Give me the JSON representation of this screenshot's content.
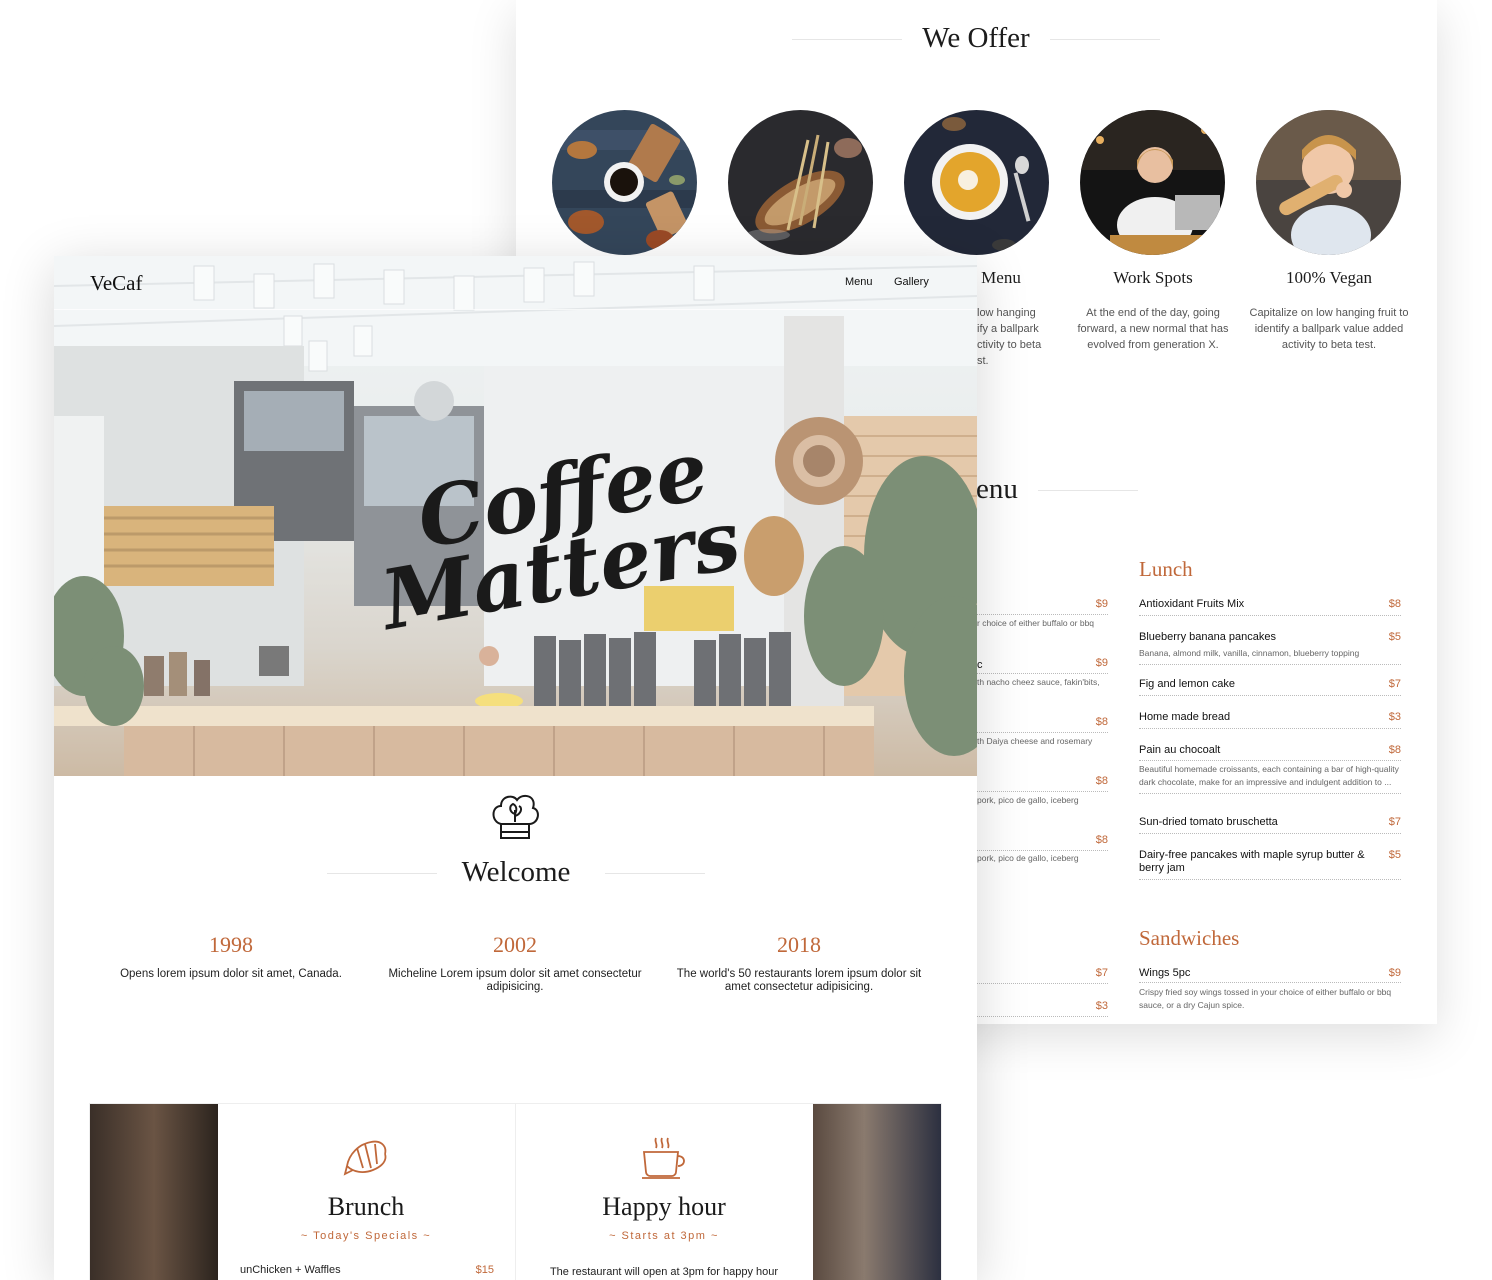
{
  "back": {
    "offer": {
      "title": "We Offer",
      "items": [
        {
          "name": "",
          "desc": ""
        },
        {
          "name": "",
          "desc": ""
        },
        {
          "name": "Menu",
          "desc": "low hanging\nify a ballpark\nctivity to beta\nst."
        },
        {
          "name": "Work Spots",
          "desc": "At the end of the day, going forward, a new normal that has evolved from generation X."
        },
        {
          "name": "100% Vegan",
          "desc": "Capitalize on low hanging fruit to identify a ballpark value added activity to beta test."
        }
      ]
    },
    "menu": {
      "title_partial": "enu",
      "left_cut": {
        "prices": [
          "$9",
          "$9",
          "$8",
          "$8",
          "$8",
          "$7",
          "$3"
        ],
        "descs": [
          "r choice of either buffalo or bbq",
          "c",
          "th nacho cheez sauce, fakin'bits,",
          "th Daiya cheese and rosemary",
          "pork, pico de gallo, iceberg",
          "pork, pico de gallo, iceberg"
        ]
      },
      "lunch": {
        "title": "Lunch",
        "items": [
          {
            "name": "Antioxidant Fruits Mix",
            "price": "$8",
            "desc": ""
          },
          {
            "name": "Blueberry banana pancakes",
            "price": "$5",
            "desc": "Banana, almond milk, vanilla, cinnamon, blueberry topping"
          },
          {
            "name": "Fig and lemon cake",
            "price": "$7",
            "desc": ""
          },
          {
            "name": "Home made bread",
            "price": "$3",
            "desc": ""
          },
          {
            "name": "Pain au chocoalt",
            "price": "$8",
            "desc": "Beautiful homemade croissants, each containing a bar of high-quality dark chocolate, make for an impressive and indulgent addition to ..."
          },
          {
            "name": "Sun-dried tomato bruschetta",
            "price": "$7",
            "desc": ""
          },
          {
            "name": "Dairy-free pancakes with maple syrup butter & berry jam",
            "price": "$5",
            "desc": ""
          }
        ]
      },
      "sandwiches": {
        "title": "Sandwiches",
        "items": [
          {
            "name": "Wings 5pc",
            "price": "$9",
            "desc": "Crispy fried soy wings tossed in your choice of either buffalo or bbq sauce, or a dry Cajun spice."
          }
        ]
      }
    }
  },
  "front": {
    "logo": "VeCaf",
    "nav": [
      "Menu",
      "Gallery"
    ],
    "hero": {
      "line1": "Coffee",
      "line2": "Matters"
    },
    "welcome": "Welcome",
    "timeline": [
      {
        "year": "1998",
        "text": "Opens lorem ipsum dolor sit amet, Canada."
      },
      {
        "year": "2002",
        "text": "Micheline Lorem ipsum dolor sit amet consectetur adipisicing."
      },
      {
        "year": "2018",
        "text": "The world's 50 restaurants lorem ipsum dolor sit amet consectetur adipisicing."
      }
    ],
    "specials": {
      "brunch": {
        "title": "Brunch",
        "sub": "~ Today's Specials ~",
        "item": "unChicken + Waffles",
        "price": "$15"
      },
      "happy": {
        "title": "Happy hour",
        "sub": "~ Starts at 3pm ~",
        "text": "The restaurant will open at 3pm for happy hour"
      }
    }
  },
  "colors": {
    "accent": "#c0683a",
    "text": "#1c1c1c",
    "page": "#ffffff"
  }
}
